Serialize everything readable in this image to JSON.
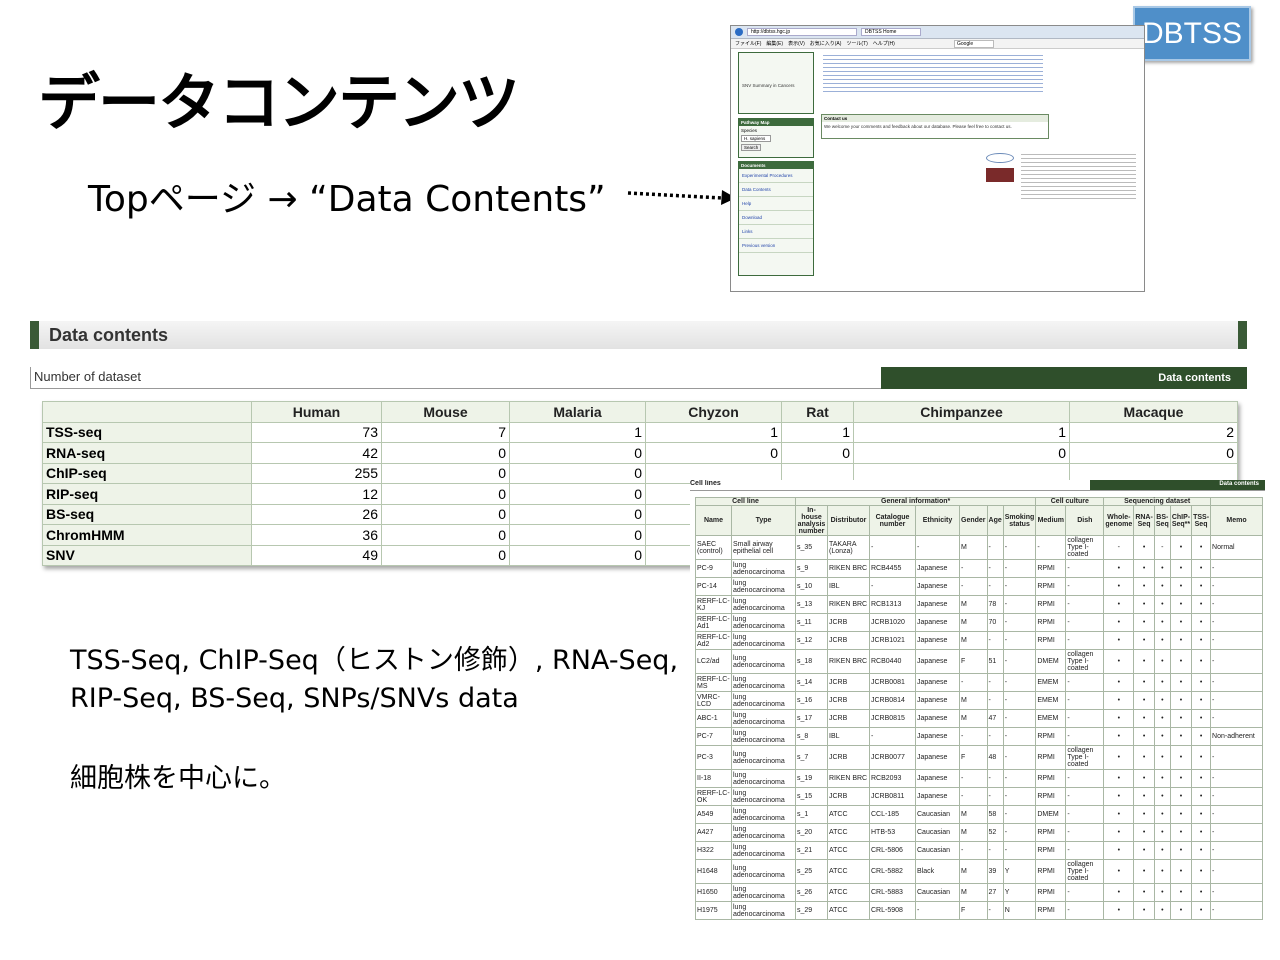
{
  "slide": {
    "title": "データコンテンツ",
    "nav": "Topページ → “Data Contents”",
    "badge": "DBTSS",
    "note_lines": [
      "TSS-Seq, ChIP-Seq（ヒストン修飾）, RNA-Seq,",
      "RIP-Seq, BS-Seq, SNPs/SNVs data"
    ],
    "note2": "細胞株を中心に。"
  },
  "browser": {
    "url": "http://dbtss.hgc.jp",
    "tab": "DBTSS Home",
    "menu": [
      "ファイル(F)",
      "編集(E)",
      "表示(V)",
      "お気に入り(A)",
      "ツール(T)",
      "ヘルプ(H)"
    ],
    "search_placeholder": "Google",
    "sidebar_top": [
      "SNV Summary in Cancers"
    ],
    "pathway_title": "Pathway Map",
    "species_label": "Species",
    "species_value": "H. sapiens",
    "search_btn": "Search",
    "documents_title": "Documents",
    "documents": [
      "Experimental Procedures",
      "Data Contents",
      "Help",
      "Download",
      "Links",
      "Previous version"
    ],
    "contact_title": "Contact us",
    "contact_text": "We welcome your comments and feedback about our database. Please feel free to contact us."
  },
  "data_contents": {
    "heading": "Data contents",
    "subheading": "Number of dataset",
    "tab_label": "Data contents",
    "columns": [
      "",
      "Human",
      "Mouse",
      "Malaria",
      "Chyzon",
      "Rat",
      "Chimpanzee",
      "Macaque"
    ],
    "rows": [
      {
        "label": "TSS-seq",
        "values": [
          "73",
          "7",
          "1",
          "1",
          "1",
          "1",
          "2"
        ]
      },
      {
        "label": "RNA-seq",
        "values": [
          "42",
          "0",
          "0",
          "0",
          "0",
          "0",
          "0"
        ]
      },
      {
        "label": "ChIP-seq",
        "values": [
          "255",
          "0",
          "0",
          "",
          "",
          "",
          ""
        ]
      },
      {
        "label": "RIP-seq",
        "values": [
          "12",
          "0",
          "0",
          "",
          "",
          "",
          ""
        ]
      },
      {
        "label": "BS-seq",
        "values": [
          "26",
          "0",
          "0",
          "",
          "",
          "",
          ""
        ]
      },
      {
        "label": "ChromHMM",
        "values": [
          "36",
          "0",
          "0",
          "",
          "",
          "",
          ""
        ]
      },
      {
        "label": "SNV",
        "values": [
          "49",
          "0",
          "0",
          "",
          "",
          "",
          ""
        ]
      }
    ]
  },
  "cell_lines": {
    "title": "Cell lines",
    "tab_label": "Data contents",
    "groups": [
      "Cell line",
      "General information*",
      "Cell culture",
      "Sequencing dataset"
    ],
    "columns": [
      "Name",
      "Type",
      "In-house analysis number",
      "Distributor",
      "Catalogue number",
      "Ethnicity",
      "Gender",
      "Age",
      "Smoking status",
      "Medium",
      "Dish",
      "Whole-genome",
      "RNA-Seq",
      "BS-Seq",
      "ChIP-Seq**",
      "TSS-Seq",
      "Memo"
    ],
    "rows": [
      [
        "SAEC (control)",
        "Small airway epithelial cell",
        "s_35",
        "TAKARA (Lonza)",
        "-",
        "-",
        "M",
        "-",
        "-",
        "-",
        "collagen Type I-coated",
        "-",
        "•",
        "-",
        "•",
        "•",
        "Normal"
      ],
      [
        "PC-9",
        "lung adenocarcinoma",
        "s_9",
        "RIKEN BRC",
        "RCB4455",
        "Japanese",
        "-",
        "-",
        "-",
        "RPMI",
        "-",
        "•",
        "•",
        "•",
        "•",
        "•",
        "-"
      ],
      [
        "PC-14",
        "lung adenocarcinoma",
        "s_10",
        "IBL",
        "-",
        "Japanese",
        "-",
        "-",
        "-",
        "RPMI",
        "-",
        "•",
        "•",
        "•",
        "•",
        "•",
        "-"
      ],
      [
        "RERF-LC-KJ",
        "lung adenocarcinoma",
        "s_13",
        "RIKEN BRC",
        "RCB1313",
        "Japanese",
        "M",
        "78",
        "-",
        "RPMI",
        "-",
        "•",
        "•",
        "•",
        "•",
        "•",
        "-"
      ],
      [
        "RERF-LC-Ad1",
        "lung adenocarcinoma",
        "s_11",
        "JCRB",
        "JCRB1020",
        "Japanese",
        "M",
        "70",
        "-",
        "RPMI",
        "-",
        "•",
        "•",
        "•",
        "•",
        "•",
        "-"
      ],
      [
        "RERF-LC-Ad2",
        "lung adenocarcinoma",
        "s_12",
        "JCRB",
        "JCRB1021",
        "Japanese",
        "M",
        "-",
        "-",
        "RPMI",
        "-",
        "•",
        "•",
        "•",
        "•",
        "•",
        "-"
      ],
      [
        "LC2/ad",
        "lung adenocarcinoma",
        "s_18",
        "RIKEN BRC",
        "RCB0440",
        "Japanese",
        "F",
        "51",
        "-",
        "DMEM",
        "collagen Type I-coated",
        "•",
        "•",
        "•",
        "•",
        "•",
        "-"
      ],
      [
        "RERF-LC-MS",
        "lung adenocarcinoma",
        "s_14",
        "JCRB",
        "JCRB0081",
        "Japanese",
        "-",
        "-",
        "-",
        "EMEM",
        "-",
        "•",
        "•",
        "•",
        "•",
        "•",
        "-"
      ],
      [
        "VMRC-LCD",
        "lung adenocarcinoma",
        "s_16",
        "JCRB",
        "JCRB0814",
        "Japanese",
        "M",
        "-",
        "-",
        "EMEM",
        "-",
        "•",
        "•",
        "•",
        "•",
        "•",
        "-"
      ],
      [
        "ABC-1",
        "lung adenocarcinoma",
        "s_17",
        "JCRB",
        "JCRB0815",
        "Japanese",
        "M",
        "47",
        "-",
        "EMEM",
        "-",
        "•",
        "•",
        "•",
        "•",
        "•",
        "-"
      ],
      [
        "PC-7",
        "lung adenocarcinoma",
        "s_8",
        "IBL",
        "-",
        "Japanese",
        "-",
        "-",
        "-",
        "RPMI",
        "-",
        "•",
        "•",
        "•",
        "•",
        "•",
        "Non-adherent"
      ],
      [
        "PC-3",
        "lung adenocarcinoma",
        "s_7",
        "JCRB",
        "JCRB0077",
        "Japanese",
        "F",
        "48",
        "-",
        "RPMI",
        "collagen Type I-coated",
        "•",
        "•",
        "•",
        "•",
        "•",
        "-"
      ],
      [
        "II-18",
        "lung adenocarcinoma",
        "s_19",
        "RIKEN BRC",
        "RCB2093",
        "Japanese",
        "-",
        "-",
        "-",
        "RPMI",
        "-",
        "•",
        "•",
        "•",
        "•",
        "•",
        "-"
      ],
      [
        "RERF-LC-OK",
        "lung adenocarcinoma",
        "s_15",
        "JCRB",
        "JCRB0811",
        "Japanese",
        "-",
        "-",
        "-",
        "RPMI",
        "-",
        "•",
        "•",
        "•",
        "•",
        "•",
        "-"
      ],
      [
        "A549",
        "lung adenocarcinoma",
        "s_1",
        "ATCC",
        "CCL-185",
        "Caucasian",
        "M",
        "58",
        "-",
        "DMEM",
        "-",
        "•",
        "•",
        "•",
        "•",
        "•",
        "-"
      ],
      [
        "A427",
        "lung adenocarcinoma",
        "s_20",
        "ATCC",
        "HTB-53",
        "Caucasian",
        "M",
        "52",
        "-",
        "RPMI",
        "-",
        "•",
        "•",
        "•",
        "•",
        "•",
        "-"
      ],
      [
        "H322",
        "lung adenocarcinoma",
        "s_21",
        "ATCC",
        "CRL-5806",
        "Caucasian",
        "-",
        "-",
        "-",
        "RPMI",
        "-",
        "•",
        "•",
        "•",
        "•",
        "•",
        "-"
      ],
      [
        "H1648",
        "lung adenocarcinoma",
        "s_25",
        "ATCC",
        "CRL-5882",
        "Black",
        "M",
        "39",
        "Y",
        "RPMI",
        "collagen Type I-coated",
        "•",
        "•",
        "•",
        "•",
        "•",
        "-"
      ],
      [
        "H1650",
        "lung adenocarcinoma",
        "s_26",
        "ATCC",
        "CRL-5883",
        "Caucasian",
        "M",
        "27",
        "Y",
        "RPMI",
        "-",
        "•",
        "•",
        "•",
        "•",
        "•",
        "-"
      ],
      [
        "H1975",
        "lung adenocarcinoma",
        "s_29",
        "ATCC",
        "CRL-5908",
        "-",
        "F",
        "-",
        "N",
        "RPMI",
        "-",
        "•",
        "•",
        "•",
        "•",
        "•",
        "-"
      ]
    ]
  }
}
